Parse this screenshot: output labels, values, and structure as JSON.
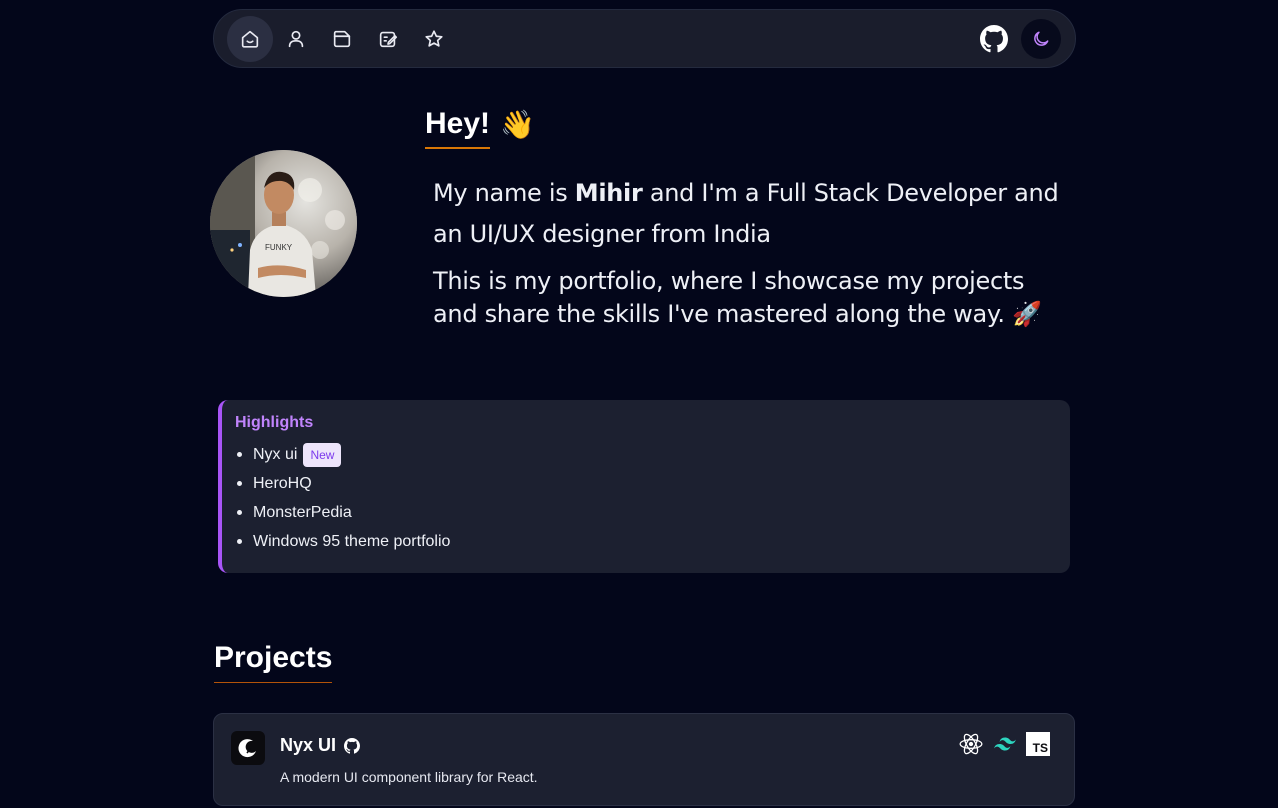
{
  "nav": {
    "items": [
      {
        "icon": "home-icon",
        "active": true
      },
      {
        "icon": "user-icon",
        "active": false
      },
      {
        "icon": "folder-icon",
        "active": false
      },
      {
        "icon": "edit-icon",
        "active": false
      },
      {
        "icon": "star-icon",
        "active": false
      }
    ],
    "right": [
      {
        "icon": "github-icon"
      },
      {
        "icon": "moon-icon"
      }
    ]
  },
  "hero": {
    "greeting": "Hey!",
    "greeting_emoji": "👋",
    "intro_pre": "My name is ",
    "intro_name": "Mihir",
    "intro_post": " and I'm a Full Stack Developer and an UI/UX designer from India",
    "intro_second": "This is my portfolio, where I showcase my projects and share the skills I've mastered along the way. 🚀"
  },
  "highlights": {
    "title": "Highlights",
    "items": [
      {
        "label": "Nyx ui",
        "badge": "New"
      },
      {
        "label": "HeroHQ"
      },
      {
        "label": "MonsterPedia"
      },
      {
        "label": "Windows 95 theme portfolio"
      }
    ]
  },
  "projects": {
    "title": "Projects",
    "cards": [
      {
        "name": "Nyx UI",
        "description": "A modern UI component library for React.",
        "stack": [
          "react-icon",
          "tailwind-icon",
          "typescript-icon"
        ],
        "ts_label": "TS"
      }
    ]
  },
  "colors": {
    "background": "#03061a",
    "card": "#1c2030",
    "accent_purple": "#a855f7",
    "highlight_title": "#c084fc",
    "underline_orange": "#d97706",
    "tailwind": "#38bdf8",
    "moon": "#c084fc"
  }
}
